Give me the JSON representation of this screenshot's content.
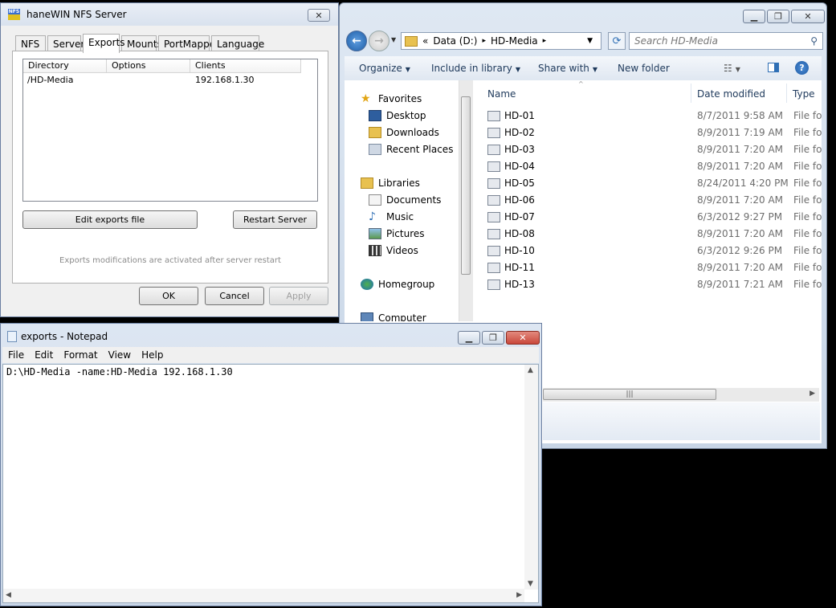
{
  "explorer": {
    "breadcrumb": [
      "«",
      "Data (D:)",
      "▸",
      "HD-Media",
      "▸"
    ],
    "search_placeholder": "Search HD-Media",
    "toolbar": {
      "organize": "Organize",
      "include_in_library": "Include in library",
      "share_with": "Share with",
      "new_folder": "New folder"
    },
    "nav": {
      "favorites": "Favorites",
      "desktop": "Desktop",
      "downloads": "Downloads",
      "recent_places": "Recent Places",
      "libraries": "Libraries",
      "documents": "Documents",
      "music": "Music",
      "pictures": "Pictures",
      "videos": "Videos",
      "homegroup": "Homegroup",
      "computer": "Computer"
    },
    "columns": {
      "name": "Name",
      "date_modified": "Date modified",
      "type": "Type"
    },
    "files": [
      {
        "name": "HD-01",
        "date": "8/7/2011 9:58 AM",
        "type": "File fol"
      },
      {
        "name": "HD-02",
        "date": "8/9/2011 7:19 AM",
        "type": "File fol"
      },
      {
        "name": "HD-03",
        "date": "8/9/2011 7:20 AM",
        "type": "File fol"
      },
      {
        "name": "HD-04",
        "date": "8/9/2011 7:20 AM",
        "type": "File fol"
      },
      {
        "name": "HD-05",
        "date": "8/24/2011 4:20 PM",
        "type": "File fol"
      },
      {
        "name": "HD-06",
        "date": "8/9/2011 7:20 AM",
        "type": "File fol"
      },
      {
        "name": "HD-07",
        "date": "6/3/2012 9:27 PM",
        "type": "File fol"
      },
      {
        "name": "HD-08",
        "date": "8/9/2011 7:20 AM",
        "type": "File fol"
      },
      {
        "name": "HD-10",
        "date": "6/3/2012 9:26 PM",
        "type": "File fol"
      },
      {
        "name": "HD-11",
        "date": "8/9/2011 7:20 AM",
        "type": "File fol"
      },
      {
        "name": "HD-13",
        "date": "8/9/2011 7:21 AM",
        "type": "File fol"
      }
    ]
  },
  "nfs": {
    "title": "haneWIN NFS Server",
    "tabs": [
      "NFS",
      "Server",
      "Exports",
      "Mounts",
      "PortMapper",
      "Language"
    ],
    "active_tab": "Exports",
    "list_headers": {
      "directory": "Directory",
      "options": "Options",
      "clients": "Clients"
    },
    "rows": [
      {
        "directory": "/HD-Media",
        "options": "",
        "clients": "192.168.1.30"
      }
    ],
    "edit_button": "Edit exports file",
    "restart_button": "Restart Server",
    "note": "Exports modifications are activated after server restart",
    "ok": "OK",
    "cancel": "Cancel",
    "apply": "Apply"
  },
  "notepad": {
    "title": "exports - Notepad",
    "menu": [
      "File",
      "Edit",
      "Format",
      "View",
      "Help"
    ],
    "content": "D:\\HD-Media -name:HD-Media 192.168.1.30"
  },
  "colors": {
    "accent": "#2f6fb5",
    "close_red": "#c9483b"
  }
}
